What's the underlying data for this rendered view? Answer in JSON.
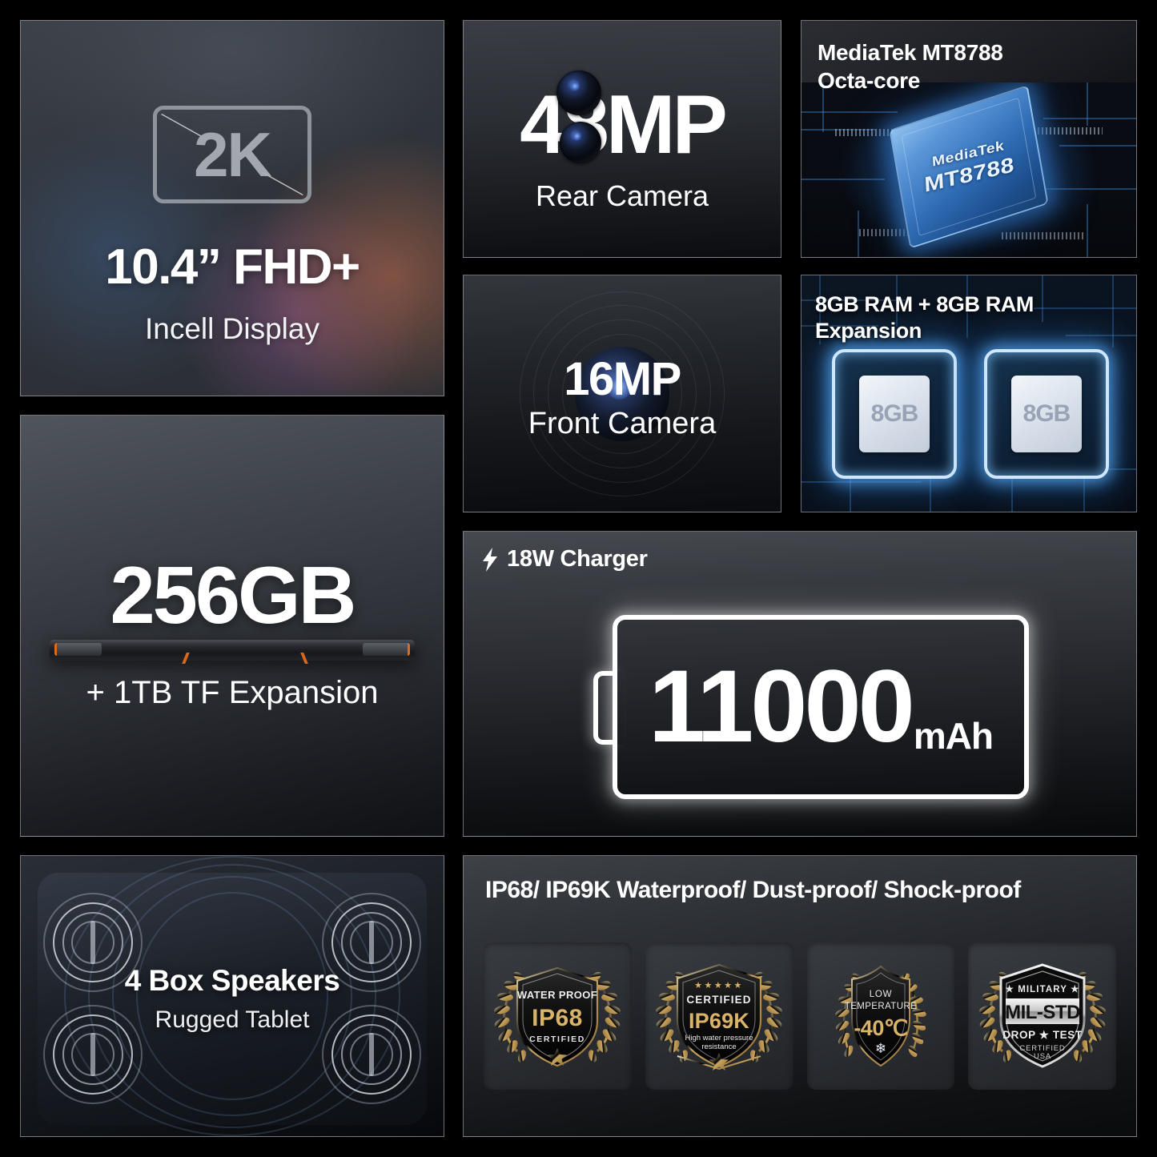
{
  "display": {
    "resolution_badge": "2K",
    "title": "10.4” FHD+",
    "subtitle": "Incell Display"
  },
  "rear_camera": {
    "value": "48",
    "unit": "MP",
    "label": "Rear Camera"
  },
  "processor": {
    "title_line1": "MediaTek MT8788",
    "title_line2": "Octa-core",
    "chip_brand": "MediaTek",
    "chip_model": "MT8788"
  },
  "front_camera": {
    "value": "16MP",
    "label": "Front Camera"
  },
  "memory": {
    "title_line1": "8GB RAM + 8GB RAM",
    "title_line2": "Expansion",
    "chip_left_label": "8GB",
    "chip_right_label": "8GB"
  },
  "storage": {
    "capacity": "256GB",
    "expansion": "+ 1TB TF Expansion"
  },
  "battery": {
    "charger": "18W Charger",
    "charger_icon": "lightning-bolt-icon",
    "capacity": "11000",
    "unit": "mAh"
  },
  "speakers": {
    "title": "4 Box Speakers",
    "subtitle": "Rugged Tablet"
  },
  "certifications": {
    "title": "IP68/ IP69K Waterproof/ Dust-proof/ Shock-proof",
    "badges": [
      {
        "id": "ip68",
        "top_text": "WATER PROOF",
        "main_text": "IP68",
        "bottom_text": "CERTIFIED",
        "has_star": true,
        "has_laurel": true
      },
      {
        "id": "ip69k",
        "top_text": "CERTIFIED",
        "main_text": "IP69K",
        "sub_line1": "High water pressure",
        "sub_line2": "resistance",
        "stars": "★ ★ ★ ★ ★",
        "has_star": true,
        "has_laurel": true
      },
      {
        "id": "low-temperature",
        "top_line1": "LOW",
        "top_line2": "TEMPERATURE",
        "main_text": "-40℃",
        "icon": "snowflake-icon",
        "has_laurel": true
      },
      {
        "id": "mil-std",
        "top_text": "★ MILITARY ★",
        "main_text": "MIL-STD",
        "mid_text": "DROP ★ TEST",
        "bottom_line1": "CERTIFIED",
        "bottom_line2": "USA",
        "has_laurel": true
      }
    ]
  },
  "colors": {
    "background": "#000000",
    "text_primary": "#ffffff",
    "gold": "#d7b168",
    "accent_blue": "#3c8ce6",
    "accent_orange": "#e06a1c",
    "panel_border": "#bebec3"
  }
}
